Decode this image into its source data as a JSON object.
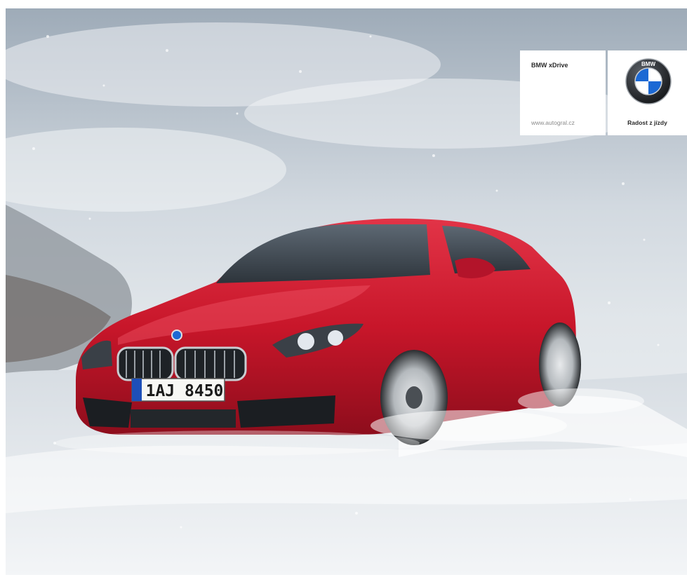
{
  "ad": {
    "headline": "BMW xDrive",
    "url": "www.autogral.cz",
    "tagline": "Radost z jízdy",
    "plate": "1AJ 8450",
    "logo_letters": "BMW"
  },
  "colors": {
    "car_red": "#c8162a",
    "panel_bg": "#ffffff",
    "logo_blue": "#1c69d4",
    "sky": "#c3ccd5"
  },
  "icons": {
    "logo": "bmw-roundel-icon"
  }
}
